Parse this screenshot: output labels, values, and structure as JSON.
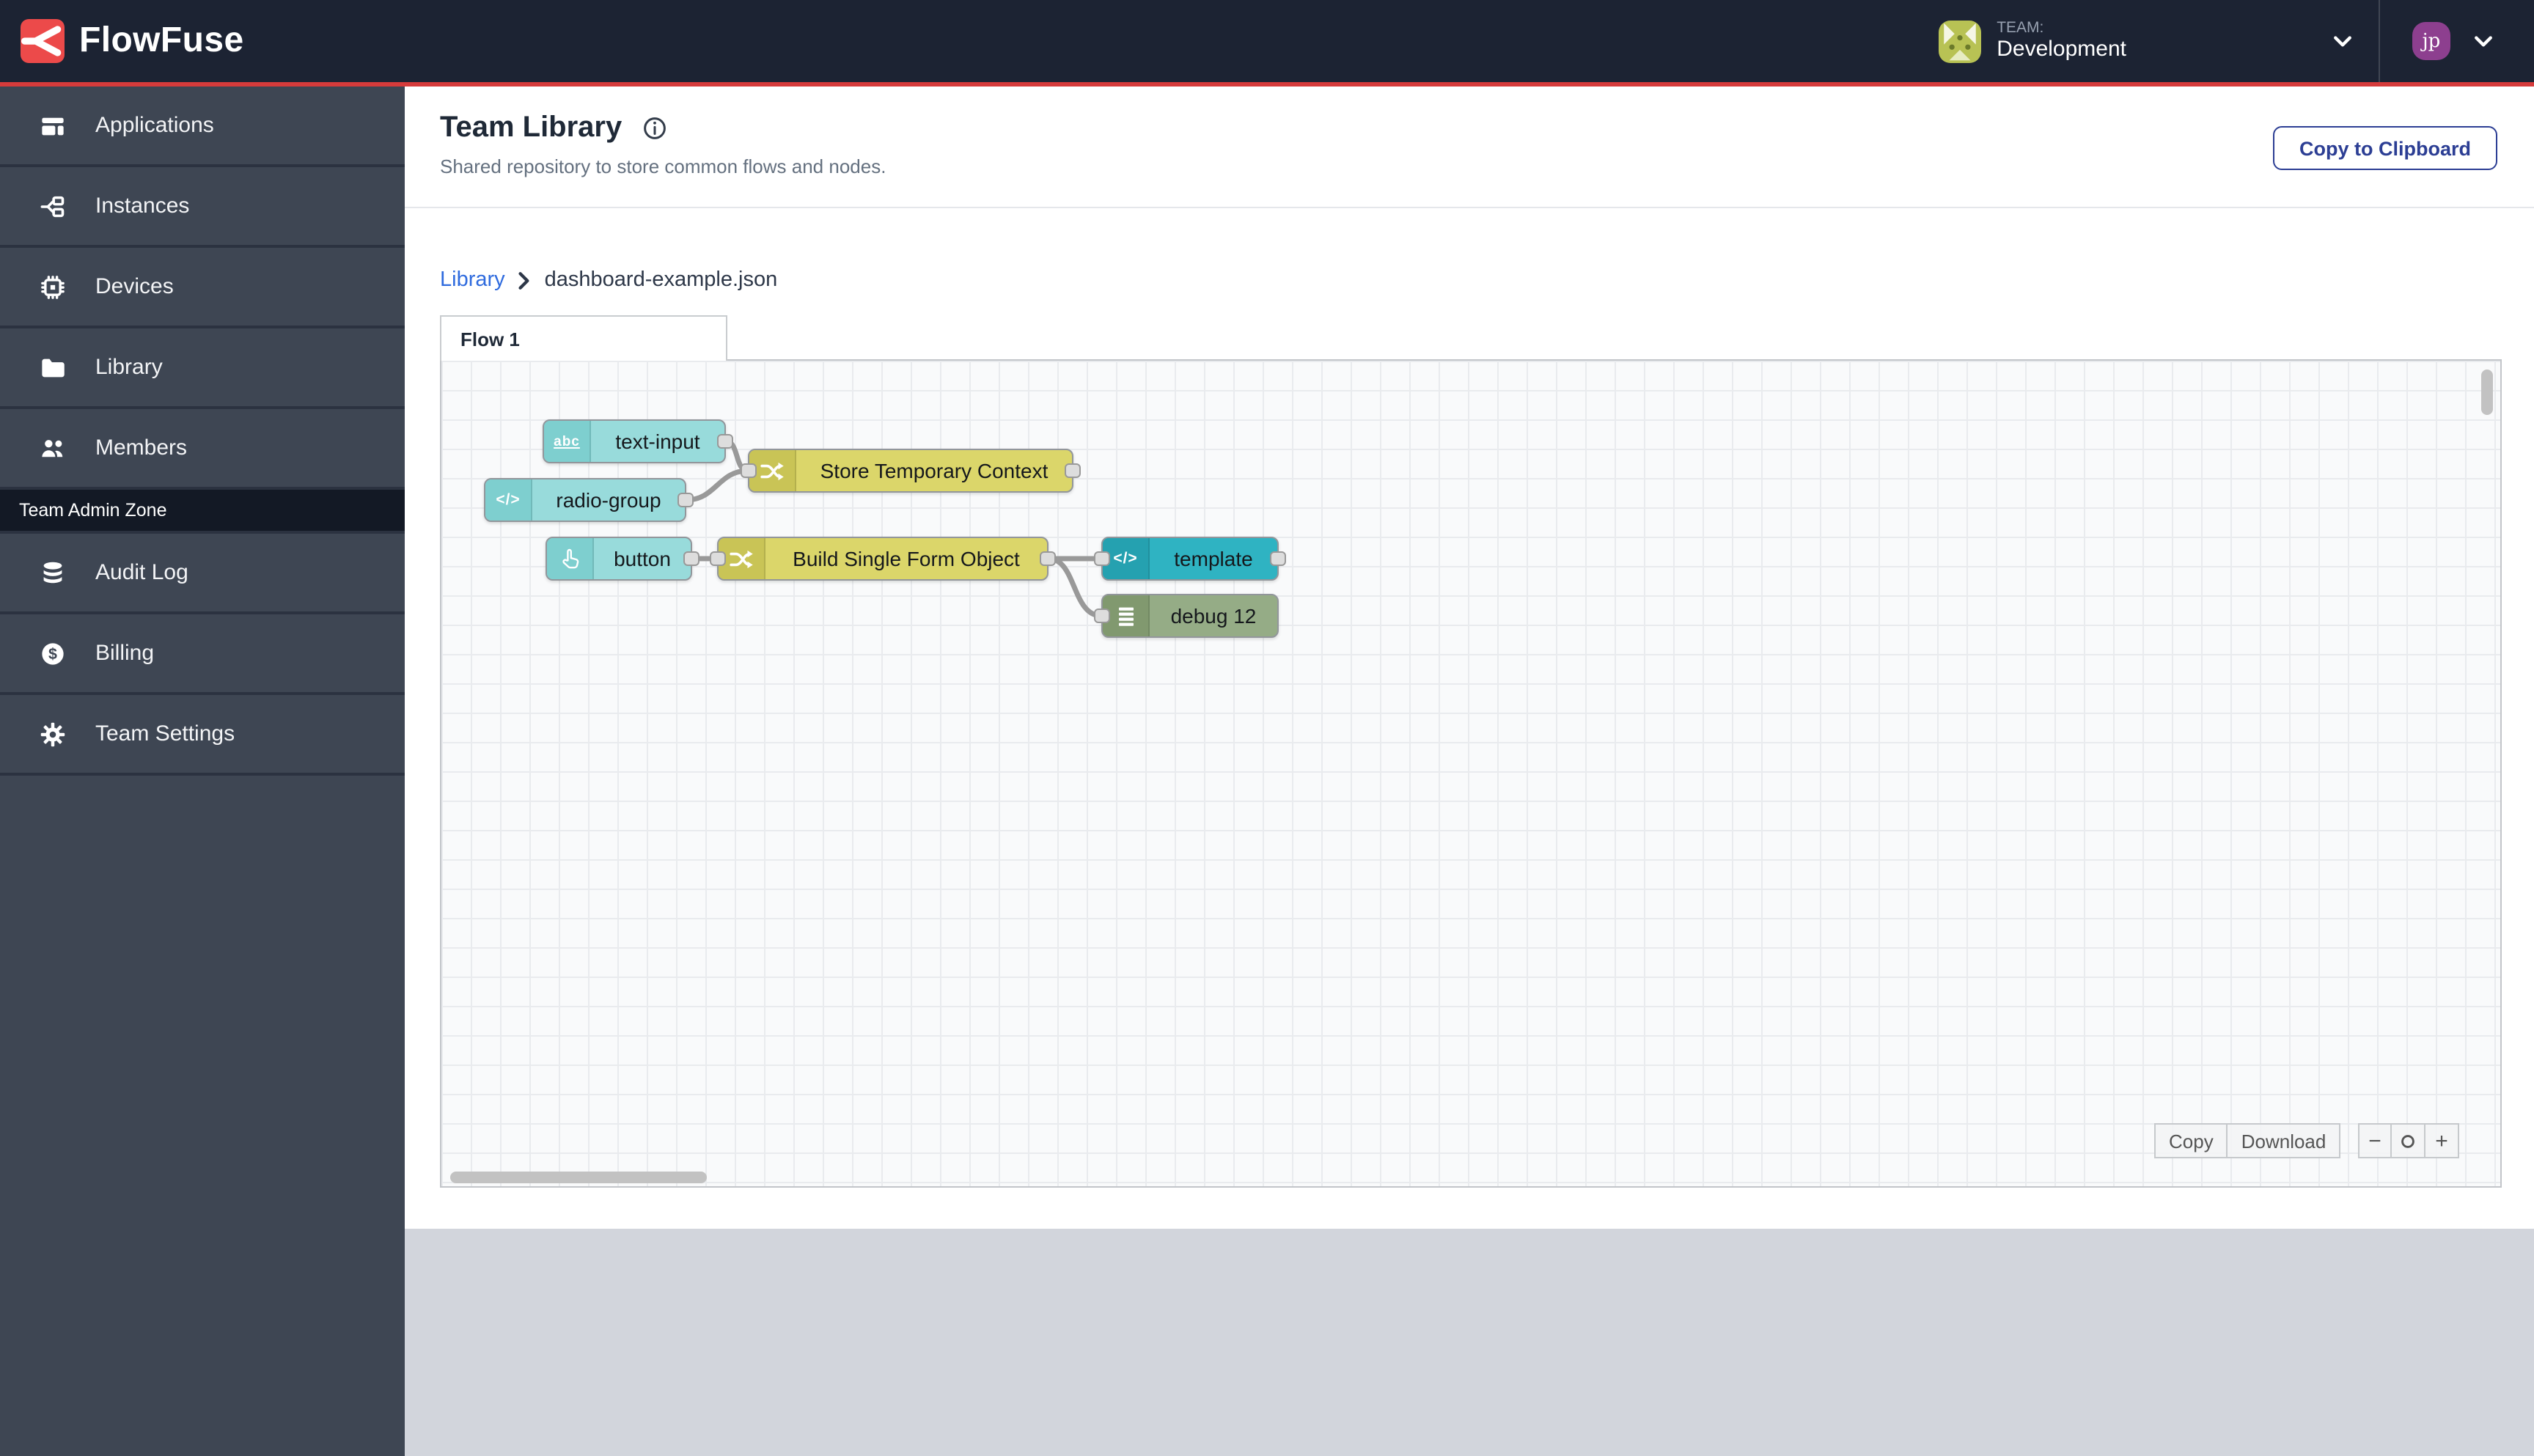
{
  "header": {
    "brand": "FlowFuse",
    "team_label": "TEAM:",
    "team_name": "Development",
    "user_initials": "jp"
  },
  "sidebar": {
    "items": [
      {
        "label": "Applications"
      },
      {
        "label": "Instances"
      },
      {
        "label": "Devices"
      },
      {
        "label": "Library"
      },
      {
        "label": "Members"
      }
    ],
    "admin_zone_label": "Team Admin Zone",
    "admin_items": [
      {
        "label": "Audit Log"
      },
      {
        "label": "Billing"
      },
      {
        "label": "Team Settings"
      }
    ]
  },
  "page": {
    "title": "Team Library",
    "subtitle": "Shared repository to store common flows and nodes.",
    "copy_to_clipboard_label": "Copy to Clipboard"
  },
  "breadcrumb": {
    "parent": "Library",
    "current": "dashboard-example.json"
  },
  "flow": {
    "tab_label": "Flow 1",
    "nodes": [
      {
        "label": "text-input",
        "kind": "widget",
        "icon_text": "abc"
      },
      {
        "label": "radio-group",
        "kind": "widget",
        "icon_text": "</>"
      },
      {
        "label": "Store Temporary Context",
        "kind": "change"
      },
      {
        "label": "button",
        "kind": "widget"
      },
      {
        "label": "Build Single Form Object",
        "kind": "change"
      },
      {
        "label": "template",
        "kind": "template",
        "icon_text": "</>"
      },
      {
        "label": "debug 12",
        "kind": "debug"
      }
    ],
    "connections": [
      {
        "from": "text-input",
        "to": "Store Temporary Context"
      },
      {
        "from": "radio-group",
        "to": "Store Temporary Context"
      },
      {
        "from": "button",
        "to": "Build Single Form Object"
      },
      {
        "from": "Build Single Form Object",
        "to": "template"
      },
      {
        "from": "Build Single Form Object",
        "to": "debug 12"
      }
    ],
    "controls": {
      "copy": "Copy",
      "download": "Download",
      "zoom_out": "−",
      "zoom_in": "+"
    }
  },
  "colors": {
    "accent_red": "#d63b3b",
    "header_bg": "#1c2333",
    "sidebar_bg": "#3e4653",
    "link_blue": "#2f6bde",
    "button_blue": "#2c3e94",
    "node_widget": "#98dbdb",
    "node_change": "#dbd66a",
    "node_template": "#2fb3c2",
    "node_debug": "#95ac86",
    "wire_gray": "#999999"
  }
}
